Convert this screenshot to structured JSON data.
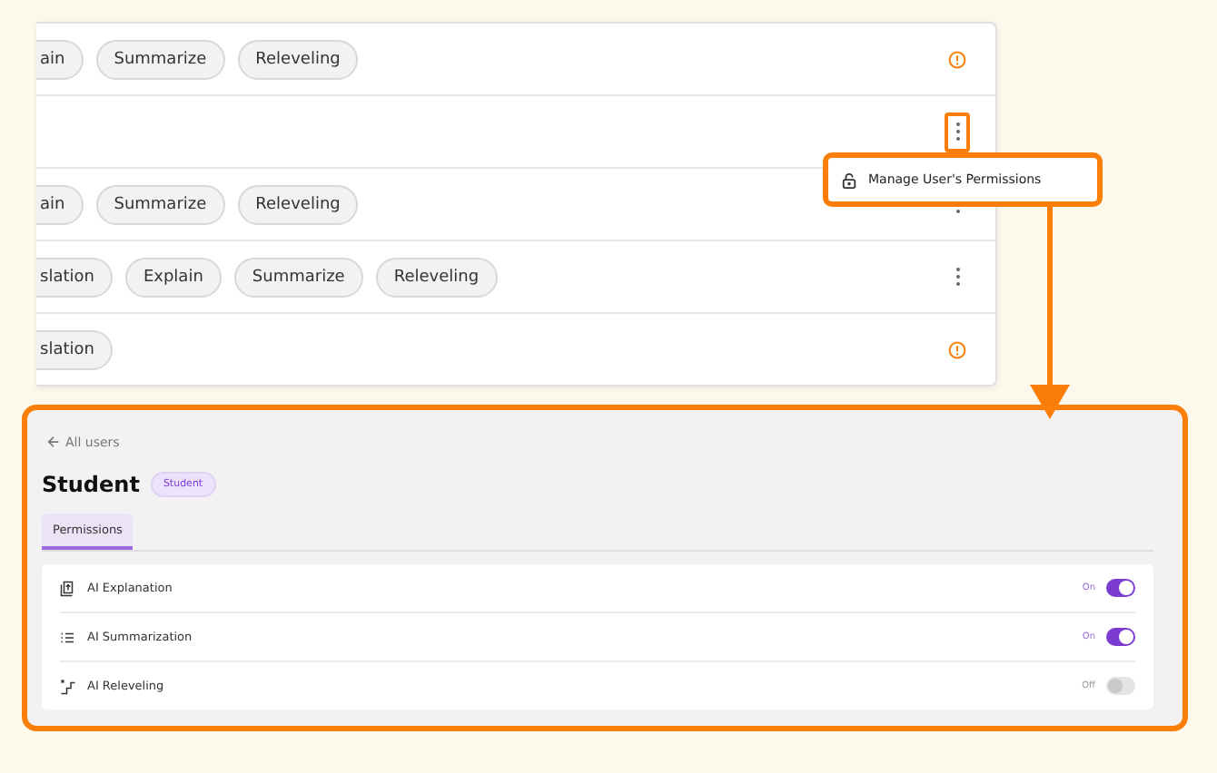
{
  "user_rows": [
    {
      "tags": [
        {
          "label": "ain",
          "cut": true
        },
        {
          "label": "Summarize",
          "cut": false
        },
        {
          "label": "Releveling",
          "cut": false
        }
      ],
      "action": {
        "kind": "alert",
        "highlighted": false
      }
    },
    {
      "tags": [],
      "action": {
        "kind": "menu",
        "highlighted": true
      }
    },
    {
      "tags": [
        {
          "label": "ain",
          "cut": true
        },
        {
          "label": "Summarize",
          "cut": false
        },
        {
          "label": "Releveling",
          "cut": false
        }
      ],
      "action": {
        "kind": "menu",
        "highlighted": false
      }
    },
    {
      "tags": [
        {
          "label": "slation",
          "cut": true
        },
        {
          "label": "Explain",
          "cut": false
        },
        {
          "label": "Summarize",
          "cut": false
        },
        {
          "label": "Releveling",
          "cut": false
        }
      ],
      "action": {
        "kind": "menu",
        "highlighted": false
      }
    },
    {
      "tags": [
        {
          "label": "slation",
          "cut": true
        }
      ],
      "action": {
        "kind": "alert",
        "highlighted": false
      }
    }
  ],
  "context_menu": {
    "items": [
      {
        "label": "Manage User's Permissions"
      }
    ]
  },
  "detail": {
    "back_link": "All users",
    "title": "Student",
    "role_badge": "Student",
    "tabs": [
      {
        "label": "Permissions",
        "selected": true
      }
    ],
    "permissions": [
      {
        "kind": "explanation",
        "label": "AI Explanation",
        "state_label": "On",
        "on": true
      },
      {
        "kind": "summarization",
        "label": "AI Summarization",
        "state_label": "On",
        "on": true
      },
      {
        "kind": "releveling",
        "label": "AI Releveling",
        "state_label": "Off",
        "on": false
      }
    ]
  }
}
